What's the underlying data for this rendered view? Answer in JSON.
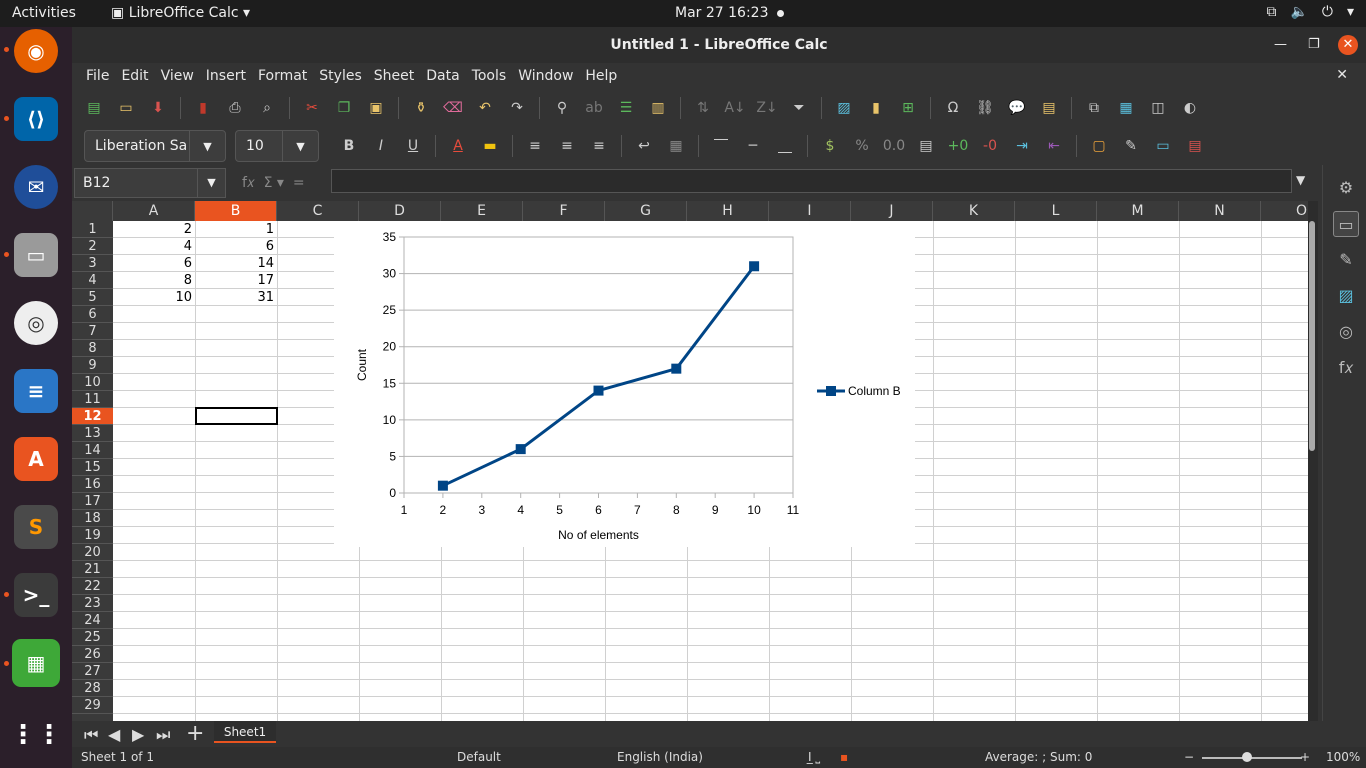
{
  "topbar": {
    "activities": "Activities",
    "app_menu": "LibreOffice Calc",
    "clock": "Mar 27  16:23"
  },
  "window": {
    "title": "Untitled 1 - LibreOffice Calc"
  },
  "menu": [
    "File",
    "Edit",
    "View",
    "Insert",
    "Format",
    "Styles",
    "Sheet",
    "Data",
    "Tools",
    "Window",
    "Help"
  ],
  "font": {
    "name": "Liberation Sa",
    "size": "10"
  },
  "formula": {
    "cell_ref": "B12",
    "value": ""
  },
  "columns": [
    "A",
    "B",
    "C",
    "D",
    "E",
    "F",
    "G",
    "H",
    "I",
    "J",
    "K",
    "L",
    "M",
    "N",
    "O"
  ],
  "selected_column": "B",
  "rows": [
    "1",
    "2",
    "3",
    "4",
    "5",
    "6",
    "7",
    "8",
    "9",
    "10",
    "11",
    "12",
    "13",
    "14",
    "15",
    "16",
    "17",
    "18",
    "19",
    "20",
    "21",
    "22",
    "23",
    "24",
    "25",
    "26",
    "27",
    "28",
    "29"
  ],
  "selected_row": "12",
  "cells": {
    "A": [
      "2",
      "4",
      "6",
      "8",
      "10"
    ],
    "B": [
      "1",
      "6",
      "14",
      "17",
      "31"
    ]
  },
  "chart_data": {
    "type": "line",
    "x": [
      2,
      4,
      6,
      8,
      10
    ],
    "series": [
      {
        "name": "Column B",
        "values": [
          1,
          6,
          14,
          17,
          31
        ],
        "color": "#004586"
      }
    ],
    "xlabel": "No of elements",
    "ylabel": "Count",
    "xlim": [
      1,
      11
    ],
    "ylim": [
      0,
      35
    ],
    "xticks": [
      1,
      2,
      3,
      4,
      5,
      6,
      7,
      8,
      9,
      10,
      11
    ],
    "yticks": [
      0,
      5,
      10,
      15,
      20,
      25,
      30,
      35
    ],
    "grid": true,
    "legend": "right"
  },
  "sheet_tab": "Sheet1",
  "status": {
    "sheet": "Sheet 1 of 1",
    "style": "Default",
    "language": "English (India)",
    "summary": "Average: ; Sum: 0",
    "zoom": "100%"
  },
  "colors": {
    "accent": "#e95420",
    "series": "#004586"
  }
}
